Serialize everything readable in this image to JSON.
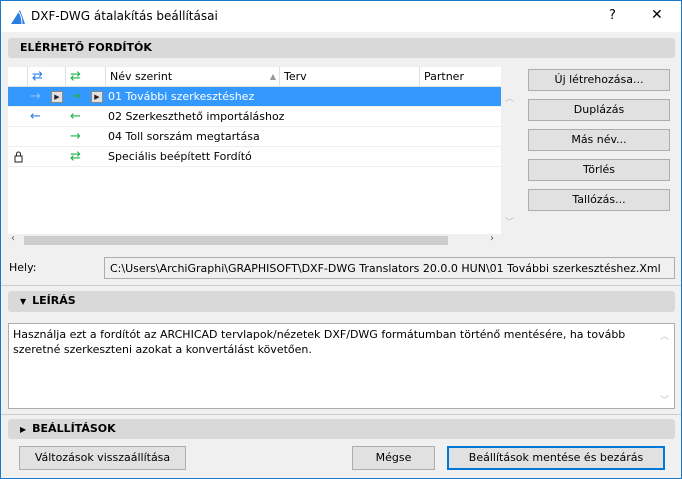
{
  "window": {
    "title": "DXF-DWG átalakítás beállításai",
    "help": "?",
    "close": "✕"
  },
  "sections": {
    "available": "ELÉRHETŐ FORDÍTÓK",
    "description": "LEÍRÁS",
    "settings": "BEÁLLÍTÁSOK"
  },
  "table": {
    "columns": [
      "Név szerint",
      "Terv",
      "Partner"
    ],
    "rows": [
      {
        "name": "01 További szerkesztéshez",
        "selected": true
      },
      {
        "name": "02 Szerkeszthető importáláshoz"
      },
      {
        "name": "04 Toll sorszám megtartása"
      },
      {
        "name": "Speciális beépített Fordító"
      }
    ]
  },
  "buttons": {
    "new": "Új létrehozása...",
    "duplicate": "Duplázás",
    "rename": "Más név...",
    "delete": "Törlés",
    "browse": "Tallózás...",
    "revert": "Változások visszaállítása",
    "cancel": "Mégse",
    "save": "Beállítások mentése és bezárás"
  },
  "location": {
    "label": "Hely:",
    "path": "C:\\Users\\ArchiGraphi\\GRAPHISOFT\\DXF-DWG Translators 20.0.0 HUN\\01 További szerkesztéshez.Xml"
  },
  "description": {
    "text": "Használja ezt a fordítót az ARCHICAD tervlapok/nézetek DXF/DWG formátumban történő mentésére, ha tovább szeretné szerkeszteni azokat a konvertálást követően."
  },
  "icons": {
    "bi_arrow": "⇄",
    "right": "→",
    "left": "←",
    "play": "▶"
  }
}
